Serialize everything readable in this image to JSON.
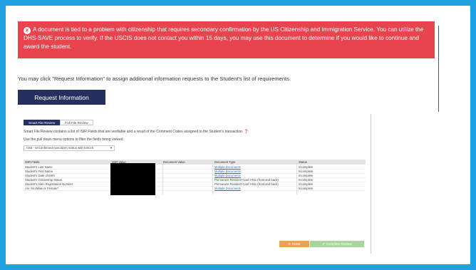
{
  "alert": {
    "icon": "x-circle-icon",
    "text": "A document is tied to a problem with citizenship that requires secondary confirmation by the US Citizenship and Immigration Service. You can utilize the DHS-SAVE process to verify. If the USCIS does not contact you within 15 days, you may use this document to determine if you would like to continue and award the student.",
    "color": "#e8444e"
  },
  "info_text": "You may click \"Request Information\" to assign additional information requests to the Student's list of requirements.",
  "request_button": "Request Information",
  "review": {
    "tabs": [
      "Smart File Review",
      "Full File Review"
    ],
    "description": "Smart File Review contains a list of ISIR Fields that are verifiable and a result of the Comment Codes assigned to the Student's transaction.",
    "help_icon": "question-circle-icon",
    "filter_hint": "Use the pull down menu options to filter the fields being viewed.",
    "filter_value": "C68 - Unconfirmed noncitizen status with USCIS",
    "columns": [
      "ISIR Fields",
      "ISIR Value",
      "Document Value",
      "Document Type",
      "Status"
    ],
    "rows": [
      {
        "field": "Student's Last Name",
        "doc_type": "Multiple Documents",
        "doc_link": true,
        "status": "Incomplete"
      },
      {
        "field": "Student's First Name",
        "doc_type": "Multiple Documents",
        "doc_link": true,
        "status": "Incomplete"
      },
      {
        "field": "Student's Date of Birth",
        "doc_type": "Multiple Documents",
        "doc_link": true,
        "status": "Incomplete"
      },
      {
        "field": "Student's Citizenship Status",
        "doc_type": "Permanent Resident Card I-551 (front and back)",
        "doc_link": false,
        "status": "Incomplete"
      },
      {
        "field": "Student's Alien Registration Number",
        "doc_type": "Permanent Resident Card I-551 (front and back)",
        "doc_link": false,
        "status": "Incomplete"
      },
      {
        "field": "Are You Male or Female?",
        "doc_type": "Multiple Documents",
        "doc_link": true,
        "status": "Incomplete"
      }
    ],
    "reset_button": "Reset",
    "complete_button": "Complete Review",
    "colors": {
      "reset": "#f0a04b",
      "complete": "#a9d69d",
      "tab_active": "#25305e"
    }
  }
}
